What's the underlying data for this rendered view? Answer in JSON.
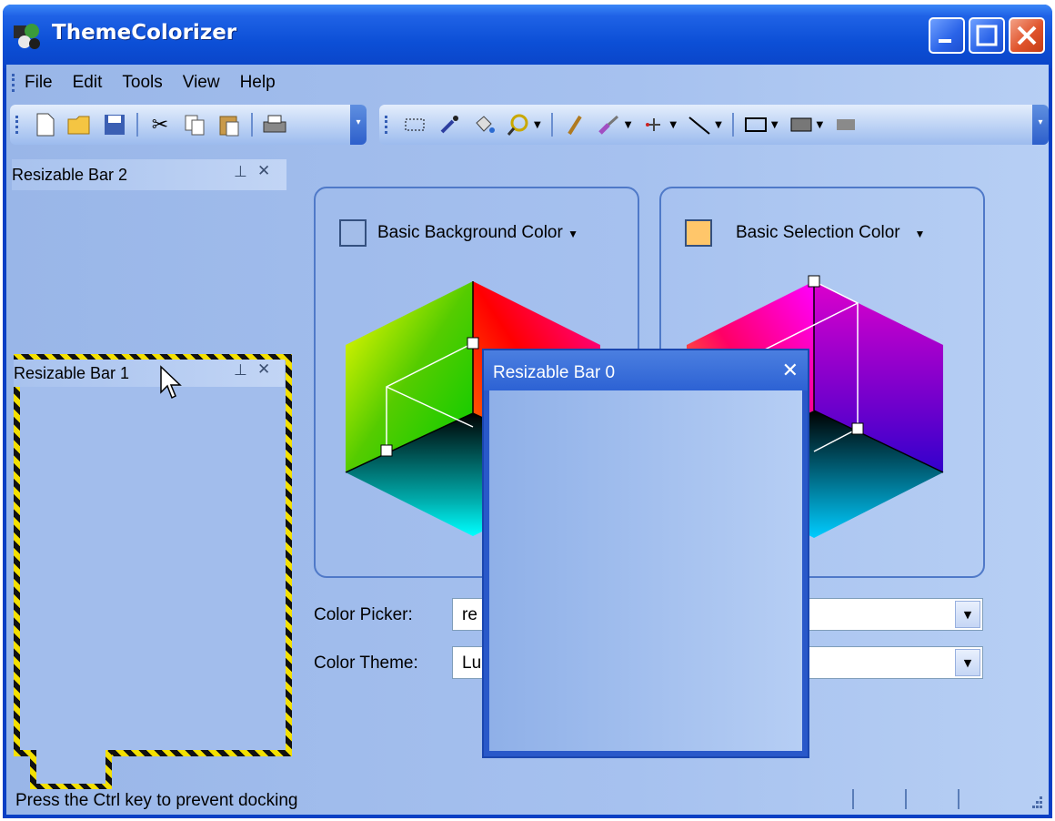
{
  "window": {
    "title": "ThemeColorizer"
  },
  "menu": {
    "file": "File",
    "edit": "Edit",
    "tools": "Tools",
    "view": "View",
    "help": "Help"
  },
  "panels": {
    "bar2": {
      "title": "Resizable Bar 2"
    },
    "bar1": {
      "title": "Resizable Bar 1"
    },
    "bar0": {
      "title": "Resizable Bar 0"
    }
  },
  "groups": {
    "background": {
      "label": "Basic Background Color",
      "swatch_color": "#a3bde9"
    },
    "selection": {
      "label": "Basic Selection Color",
      "swatch_color": "#ffc66a"
    }
  },
  "fields": {
    "color_picker": {
      "label": "Color Picker:",
      "value": "re"
    },
    "color_theme": {
      "label": "Color Theme:",
      "value": "Lu"
    }
  },
  "status": {
    "text": "Press the Ctrl key to prevent docking"
  },
  "colors": {
    "title_blue": "#0c4fd6",
    "client_bg": "#a6c1ef",
    "hazard_yellow": "#f3e000"
  }
}
